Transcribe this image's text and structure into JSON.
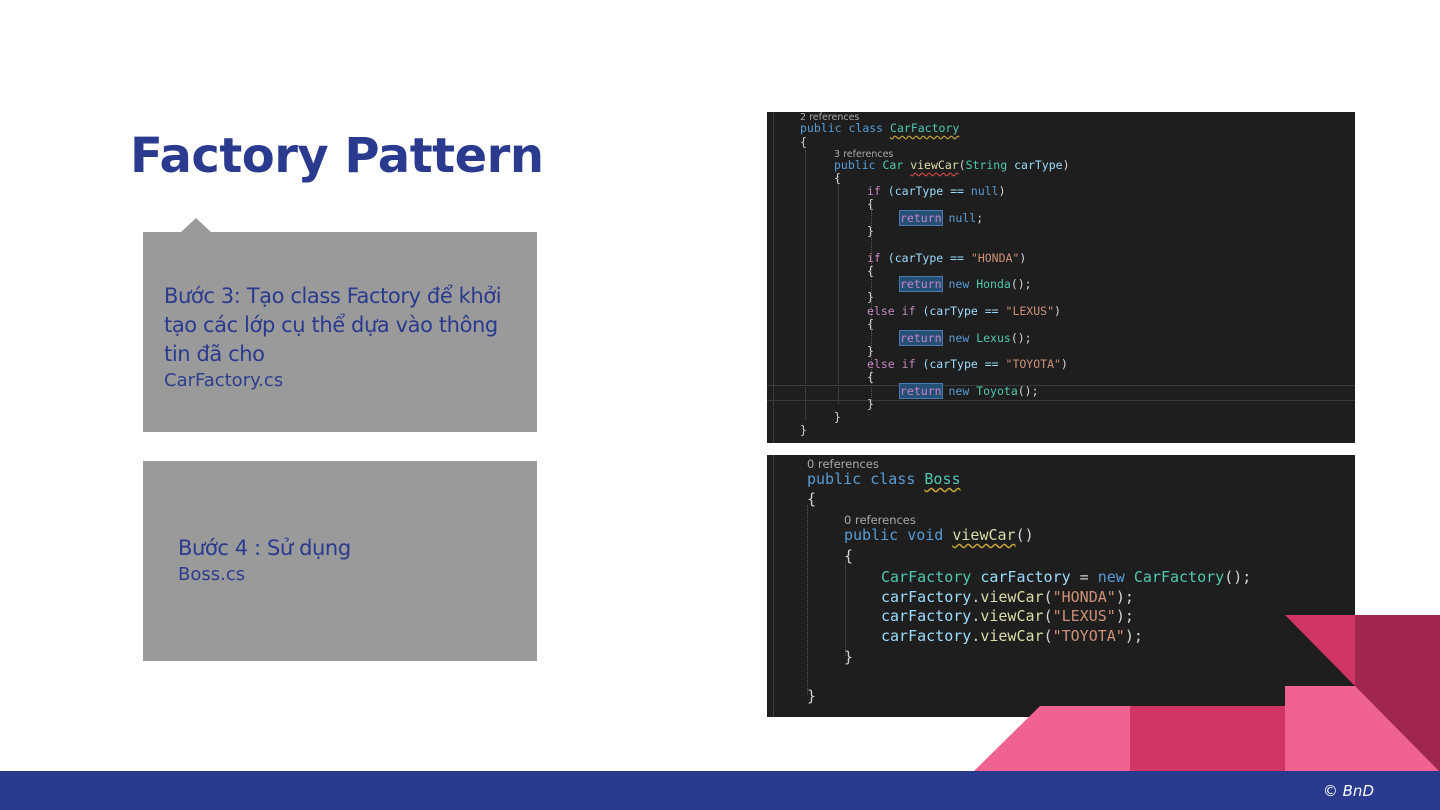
{
  "slide": {
    "title": "Factory Pattern",
    "footer": "© BnD"
  },
  "step3": {
    "text": "Bước 3:  Tạo class Factory để khởi tạo các lớp cụ thể dựa vào thông tin đã cho",
    "file": "CarFactory.cs"
  },
  "step4": {
    "text": "Bước 4 : Sử dụng",
    "file": "Boss.cs"
  },
  "code_carfactory": {
    "refs_class": "2 references",
    "l_class": [
      "public",
      "class",
      "CarFactory"
    ],
    "brace_open": "{",
    "refs_method": "3 references",
    "l_method": [
      "public",
      "Car",
      "viewCar",
      "(",
      "String",
      "carType",
      ")"
    ],
    "l_if_null": [
      "if",
      "(carType == ",
      "null",
      ")"
    ],
    "l_return_null": [
      "return",
      "null",
      ";"
    ],
    "l_if_honda": [
      "if",
      "(carType == ",
      "\"HONDA\"",
      ")"
    ],
    "l_return_honda": [
      "return",
      "new",
      "Honda",
      "();"
    ],
    "l_else_lexus": [
      "else",
      "if",
      "(carType == ",
      "\"LEXUS\"",
      ")"
    ],
    "l_return_lexus": [
      "return",
      "new",
      "Lexus",
      "();"
    ],
    "l_else_toyota": [
      "else",
      "if",
      "(carType == ",
      "\"TOYOTA\"",
      ")"
    ],
    "l_return_toyota": [
      "return",
      "new",
      "Toyota",
      "();"
    ],
    "brace_close": "}"
  },
  "code_boss": {
    "refs_class": "0 references",
    "l_class": [
      "public",
      "class",
      "Boss"
    ],
    "brace_open": "{",
    "refs_method": "0 references",
    "l_method": [
      "public",
      "void",
      "viewCar",
      "()"
    ],
    "l_decl": [
      "CarFactory",
      "carFactory",
      " = ",
      "new",
      "CarFactory",
      "();"
    ],
    "call_obj": "carFactory",
    "call_fn": "viewCar",
    "calls": [
      "\"HONDA\"",
      "\"LEXUS\"",
      "\"TOYOTA\""
    ],
    "brace_close": "}"
  },
  "colors": {
    "title": "#2a3a8f",
    "box": "#9a9a9a",
    "footer": "#2a3a8f",
    "pink": "#f0628f",
    "crimson": "#d03565",
    "maroon": "#a0264d"
  }
}
